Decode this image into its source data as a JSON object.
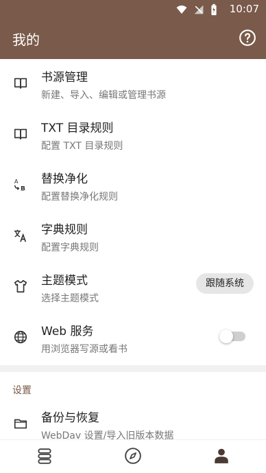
{
  "status": {
    "time": "10:07"
  },
  "appbar": {
    "title": "我的"
  },
  "items": [
    {
      "title": "书源管理",
      "subtitle": "新建、导入、编辑或管理书源"
    },
    {
      "title": "TXT 目录规则",
      "subtitle": "配置 TXT 目录规则"
    },
    {
      "title": "替换净化",
      "subtitle": "配置替换净化规则"
    },
    {
      "title": "字典规则",
      "subtitle": "配置字典规则"
    },
    {
      "title": "主题模式",
      "subtitle": "选择主题模式",
      "pill": "跟随系统"
    },
    {
      "title": "Web 服务",
      "subtitle": "用浏览器写源或看书",
      "switch_on": false
    }
  ],
  "section_settings": "设置",
  "settings_items": [
    {
      "title": "备份与恢复",
      "subtitle": "WebDav 设置/导入旧版本数据"
    }
  ],
  "bottom_nav": {
    "active": "profile"
  },
  "colors": {
    "primary": "#7a5a4a",
    "muted": "#777777"
  }
}
